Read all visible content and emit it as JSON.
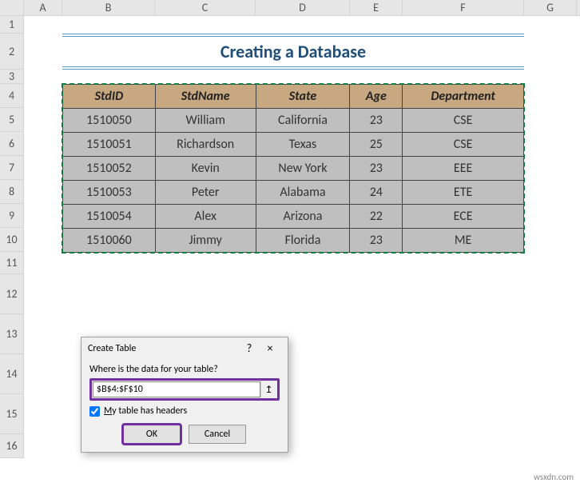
{
  "columns": {
    "A": "A",
    "B": "B",
    "C": "C",
    "D": "D",
    "E": "E",
    "F": "F",
    "G": "G"
  },
  "rows": [
    "1",
    "2",
    "3",
    "4",
    "5",
    "6",
    "7",
    "8",
    "9",
    "10",
    "11",
    "12",
    "13",
    "14",
    "15",
    "16"
  ],
  "title": "Creating a Database",
  "headers": {
    "B": "StdID",
    "C": "StdName",
    "D": "State",
    "E": "Age",
    "F": "Department"
  },
  "data": [
    {
      "B": "1510050",
      "C": "William",
      "D": "California",
      "E": "23",
      "F": "CSE"
    },
    {
      "B": "1510051",
      "C": "Richardson",
      "D": "Texas",
      "E": "25",
      "F": "CSE"
    },
    {
      "B": "1510052",
      "C": "Kevin",
      "D": "New York",
      "E": "23",
      "F": "EEE"
    },
    {
      "B": "1510053",
      "C": "Peter",
      "D": "Alabama",
      "E": "24",
      "F": "ETE"
    },
    {
      "B": "1510054",
      "C": "Alex",
      "D": "Arizona",
      "E": "22",
      "F": "ECE"
    },
    {
      "B": "1510060",
      "C": "Jimmy",
      "D": "Florida",
      "E": "23",
      "F": "ME"
    }
  ],
  "dialog": {
    "title": "Create Table",
    "help": "?",
    "close": "×",
    "message": "Where is the data for your table?",
    "range": "$B$4:$F$10",
    "range_btn": "↥",
    "checkbox_prefix": "M",
    "checkbox_rest": "y table has headers",
    "checkbox_checked": true,
    "ok": "OK",
    "cancel": "Cancel"
  },
  "watermark": "wsxdn.com",
  "chart_data": {
    "type": "table",
    "title": "Creating a Database",
    "columns": [
      "StdID",
      "StdName",
      "State",
      "Age",
      "Department"
    ],
    "rows": [
      [
        1510050,
        "William",
        "California",
        23,
        "CSE"
      ],
      [
        1510051,
        "Richardson",
        "Texas",
        25,
        "CSE"
      ],
      [
        1510052,
        "Kevin",
        "New York",
        23,
        "EEE"
      ],
      [
        1510053,
        "Peter",
        "Alabama",
        24,
        "ETE"
      ],
      [
        1510054,
        "Alex",
        "Arizona",
        22,
        "ECE"
      ],
      [
        1510060,
        "Jimmy",
        "Florida",
        23,
        "ME"
      ]
    ]
  }
}
